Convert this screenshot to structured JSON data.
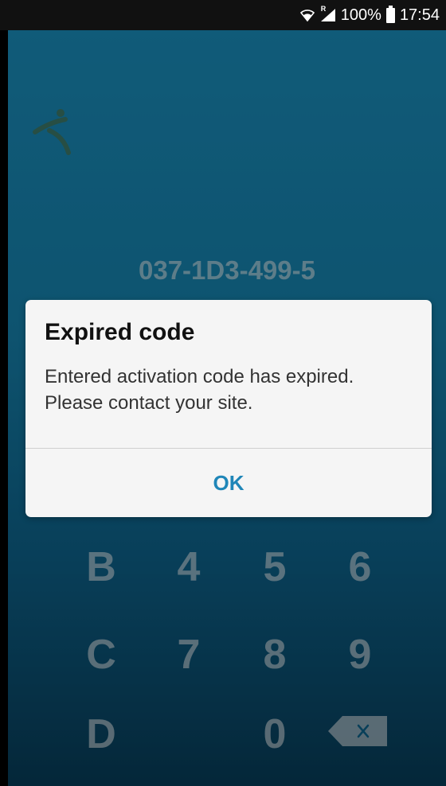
{
  "status_bar": {
    "wifi_icon": "wifi-icon",
    "signal_icon": "signal-icon",
    "signal_badge": "R",
    "battery_percent": "100%",
    "battery_icon": "battery-icon",
    "time": "17:54"
  },
  "app": {
    "logo_icon": "person-logo-icon",
    "activation_code": "037-1D3-499-5",
    "keypad": {
      "rows": [
        [
          "B",
          "4",
          "5",
          "6"
        ],
        [
          "C",
          "7",
          "8",
          "9"
        ],
        [
          "D",
          "",
          "0",
          "backspace"
        ]
      ],
      "backspace_icon": "backspace-icon"
    },
    "colors": {
      "gradient_top": "#1b93c3",
      "gradient_bottom": "#083f5c",
      "accent": "#1f86b8"
    }
  },
  "dialog": {
    "title": "Expired code",
    "message_line1": "Entered activation code has expired.",
    "message_line2": "Please contact your site.",
    "ok_label": "OK"
  }
}
